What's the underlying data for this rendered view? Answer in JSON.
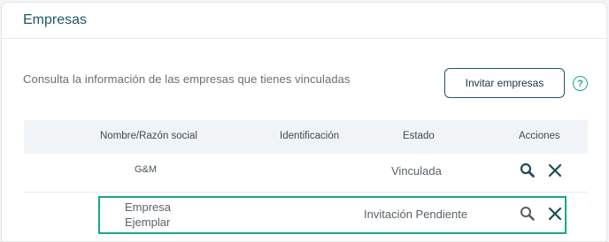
{
  "section": {
    "title": "Empresas",
    "intro": "Consulta la información de las empresas que tienes vinculadas",
    "invite_label": "Invitar empresas",
    "help_glyph": "?"
  },
  "table": {
    "headers": {
      "name": "Nombre/Razón social",
      "id": "Identificación",
      "status": "Estado",
      "actions": "Acciones"
    },
    "rows": [
      {
        "name": "G&M",
        "identification": "",
        "status": "Vinculada",
        "actions": [
          "search-icon",
          "close-icon"
        ]
      },
      {
        "name_line1": "Empresa",
        "name_line2": "Ejemplar",
        "identification": "",
        "status": "Invitación Pendiente",
        "actions": [
          "search-icon",
          "close-icon"
        ]
      }
    ]
  },
  "colors": {
    "accent": "#1aa58d",
    "brand_dark": "#1d5866",
    "icon_dark": "#1d4c56"
  }
}
